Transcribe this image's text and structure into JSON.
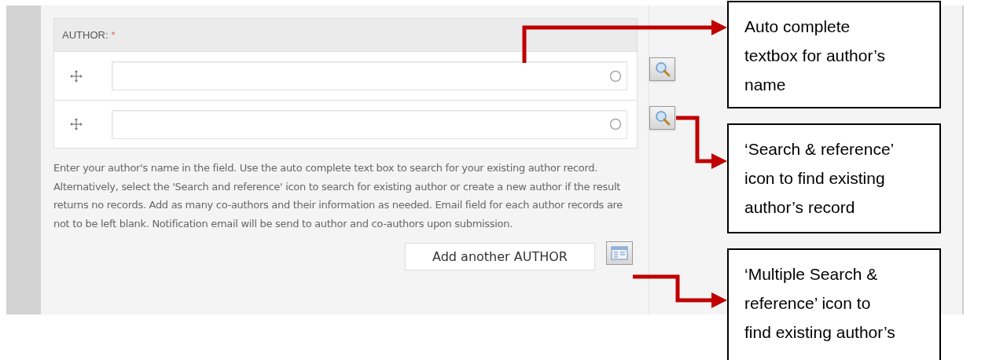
{
  "form": {
    "label": "AUTHOR:",
    "required_mark": "*",
    "author_rows": [
      {
        "kind": "autocomplete"
      },
      {
        "kind": "autocomplete"
      }
    ],
    "help_text": "Enter your author's name in the field. Use the auto complete text box to search for your existing author record. Alternatively, select the 'Search and reference' icon to search for existing author or create a new author if the result returns no records. Add as many co-authors and their information as needed. Email field for each author records are not to be left blank. Notification email will be send to author and co-authors upon submission.",
    "add_button": "Add another AUTHOR"
  },
  "callouts": [
    {
      "lines": [
        "Auto complete",
        "textbox for author’s",
        "name"
      ],
      "kind": "field"
    },
    {
      "lines": [
        "‘Search & reference’",
        "icon to find existing",
        "author’s record"
      ],
      "kind": "search"
    },
    {
      "lines": [
        "‘Multiple Search &",
        "reference’ icon to",
        "find existing author’s"
      ],
      "kind": "multi"
    }
  ]
}
